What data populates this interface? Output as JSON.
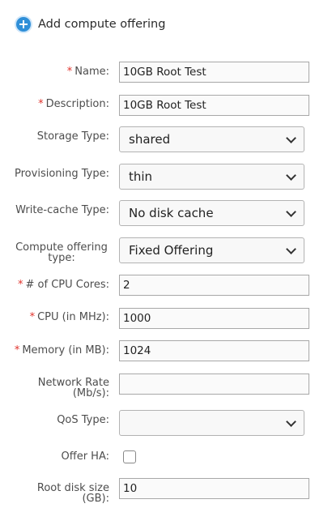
{
  "header": {
    "title": "Add compute offering"
  },
  "form": {
    "name": {
      "label": "Name:",
      "value": "10GB Root Test"
    },
    "description": {
      "label": "Description:",
      "value": "10GB Root Test"
    },
    "storage_type": {
      "label": "Storage Type:",
      "value": "shared"
    },
    "provisioning_type": {
      "label": "Provisioning Type:",
      "value": "thin"
    },
    "write_cache_type": {
      "label": "Write-cache Type:",
      "value": "No disk cache"
    },
    "compute_offering_type": {
      "label_line1": "Compute offering",
      "label_line2": "type:",
      "value": "Fixed Offering"
    },
    "cpu_cores": {
      "label": "# of CPU Cores:",
      "value": "2"
    },
    "cpu_mhz": {
      "label": "CPU (in MHz):",
      "value": "1000"
    },
    "memory_mb": {
      "label": "Memory (in MB):",
      "value": "1024"
    },
    "network_rate": {
      "label_line1": "Network Rate",
      "label_line2": "(Mb/s):",
      "value": ""
    },
    "qos_type": {
      "label": "QoS Type:",
      "value": ""
    },
    "offer_ha": {
      "label": "Offer HA:",
      "checked": false
    },
    "root_disk_size": {
      "label_line1": "Root disk size",
      "label_line2": "(GB):",
      "value": "10"
    }
  },
  "required_marker": "*"
}
